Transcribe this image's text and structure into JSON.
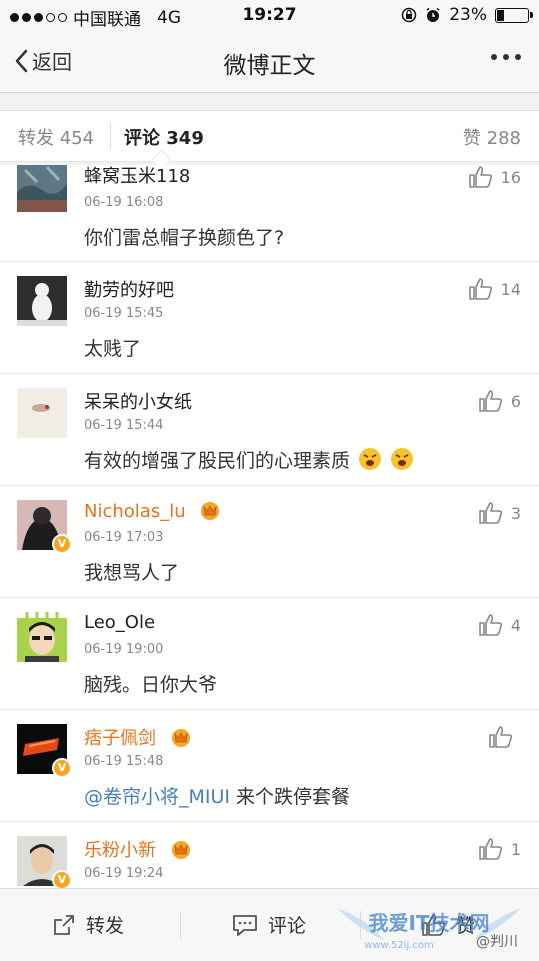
{
  "status_bar": {
    "carrier": "中国联通",
    "network": "4G",
    "time": "19:27",
    "battery": "23%",
    "battery_level": 0.23
  },
  "nav": {
    "back_label": "返回",
    "title": "微博正文"
  },
  "tabs": {
    "repost": "转发 454",
    "comment_label": "评论",
    "comment_count": "349",
    "like": "赞 288"
  },
  "comments": [
    {
      "name": "蜂窝玉米118",
      "time": "06-19 16:08",
      "text": "你们雷总帽子换颜色了?",
      "likes": "16"
    },
    {
      "name": "勤劳的好吧",
      "time": "06-19 15:45",
      "text": "太贱了",
      "likes": "14"
    },
    {
      "name": "呆呆的小女纸",
      "time": "06-19 15:44",
      "text": "有效的增强了股民们的心理素质",
      "likes": "6"
    },
    {
      "name": "Nicholas_lu",
      "time": "06-19 17:03",
      "text": "我想骂人了",
      "likes": "3"
    },
    {
      "name": "Leo_Ole",
      "time": "06-19 19:00",
      "text": "脑残。日你大爷",
      "likes": "4"
    },
    {
      "name": "痞子佩剑",
      "time": "06-19 15:48",
      "mention": "@卷帘小将_MIUI",
      "text": " 来个跌停套餐",
      "likes": ""
    },
    {
      "name": "乐粉小新",
      "time": "06-19 19:24",
      "text": "",
      "likes": "1"
    }
  ],
  "toolbar": {
    "repost": "转发",
    "comment": "评论",
    "like": "赞"
  },
  "watermark": {
    "text": "我爱IT技术网",
    "url": "www.52ij.com",
    "handle": "@判川"
  },
  "colors": {
    "vip_orange": "#e8741a",
    "mention_blue": "#4a7dbd",
    "verified_badge": "#f5a623"
  }
}
